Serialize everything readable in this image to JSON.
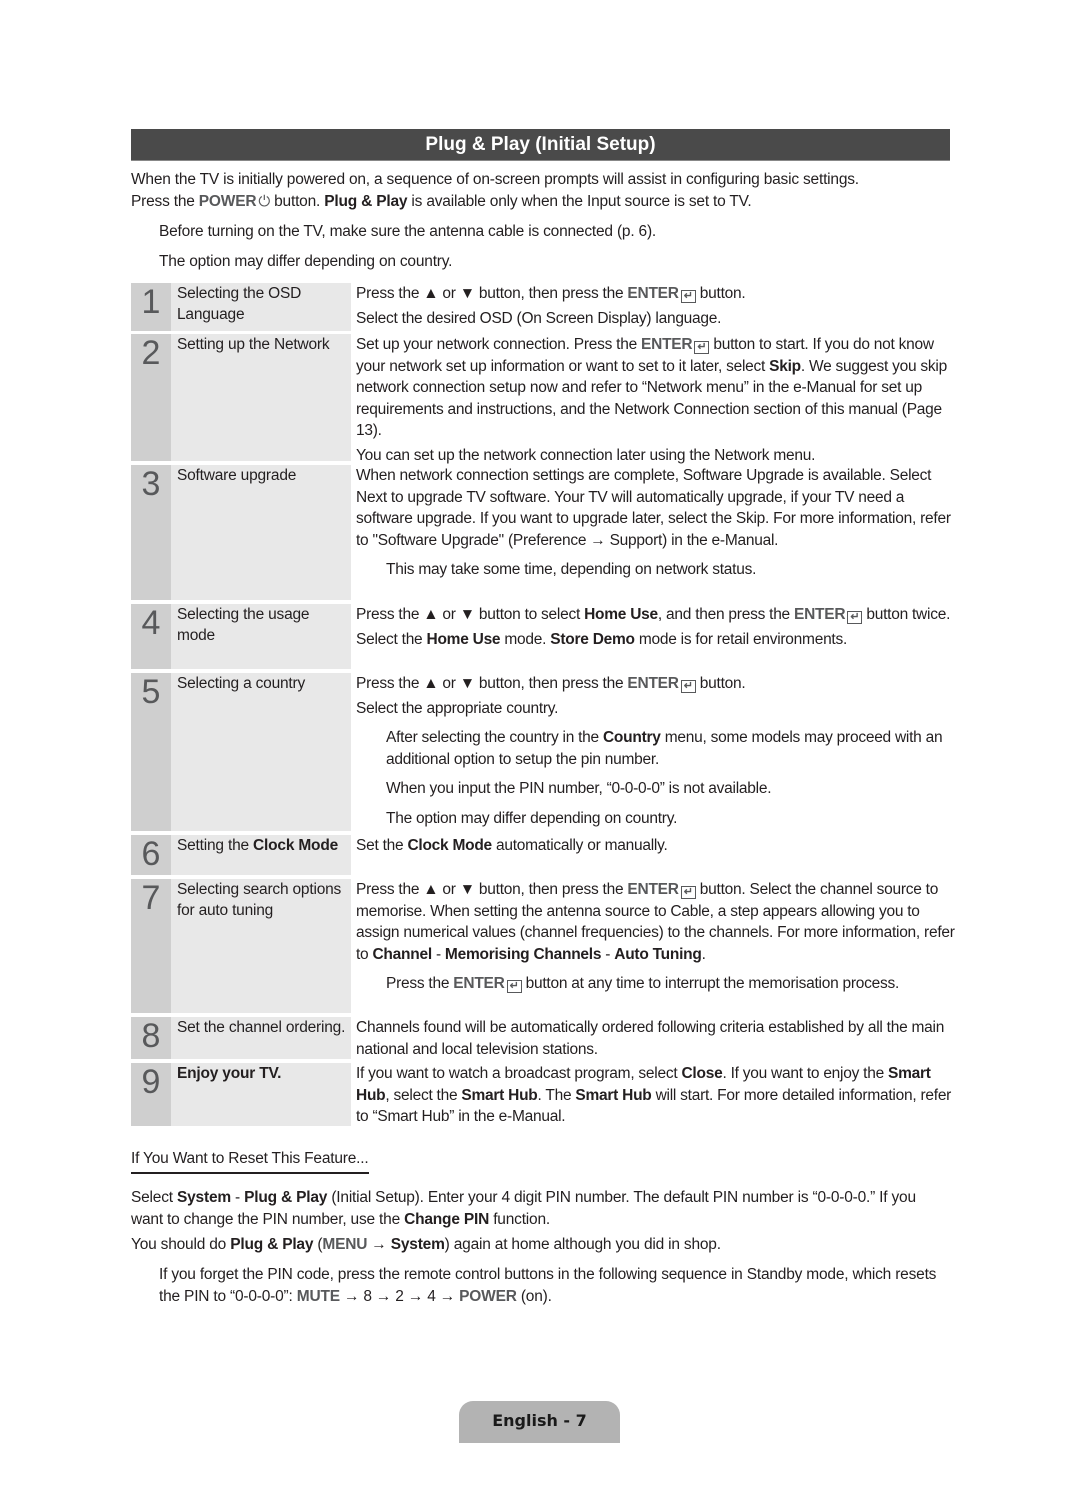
{
  "title": "Plug & Play (Initial Setup)",
  "intro": {
    "line1": "When the TV is initially powered on, a sequence of on-screen prompts will assist in configuring basic settings.",
    "line2_a": "Press the ",
    "power_label": "POWER",
    "power_icon": "power-icon",
    "line2_b": " button. ",
    "plug_play": "Plug & Play",
    "line2_c": " is available only when the Input source is set to TV."
  },
  "notes": [
    "Before turning on the TV, make sure the antenna cable is connected (p. 6).",
    "The option may differ depending on country."
  ],
  "enter_label": "ENTER",
  "enter_icon": "enter-icon",
  "steps": [
    {
      "number": "1",
      "label": "Selecting the OSD Language",
      "lines": [
        {
          "a": "Press the ▲ or ▼ button, then press the ",
          "b": " button."
        },
        "Select the desired OSD (On Screen Display) language."
      ]
    },
    {
      "number": "2",
      "label": "Setting up the Network",
      "lines": [
        {
          "a": "Set up your network connection. Press the ",
          "b": " button to start. If you do not know your network set up information or want to set to it later, select ",
          "bold": "Skip",
          "c": ". We suggest you skip network connection setup now and refer to “Network menu” in the e-Manual for set up requirements and instructions, and the Network Connection section of this manual (Page 13)."
        },
        "You can set up the network connection later using the Network menu."
      ]
    },
    {
      "number": "3",
      "label": "Software upgrade",
      "lines": [
        "When network connection settings are complete, Software Upgrade is available. Select Next to upgrade TV software. Your TV will automatically upgrade, if your TV need a software upgrade. If you want to upgrade later, select the Skip. For more information, refer to \"Software Upgrade\" (Preference → Support) in the e-Manual."
      ],
      "notes": [
        "This may take some time, depending on network status."
      ]
    },
    {
      "number": "4",
      "label": "Selecting the usage mode",
      "lines": [
        {
          "a": "Press the ▲ or ▼ button to select ",
          "bold": "Home Use",
          "b": ", and then press the ",
          "c": " button twice."
        },
        {
          "a": "Select the ",
          "bold1": "Home Use",
          "b": " mode. ",
          "bold2": "Store Demo",
          "c": " mode is for retail environments."
        }
      ]
    },
    {
      "number": "5",
      "label": "Selecting a country",
      "lines": [
        {
          "a": "Press the ▲ or ▼ button, then press the ",
          "b": " button."
        },
        "Select the appropriate country."
      ],
      "notes": [
        {
          "a": "After selecting the country in the ",
          "bold": "Country",
          "b": " menu, some models may proceed with an additional option to setup the pin number."
        },
        "When you input the PIN number, “0-0-0-0” is not available.",
        "The option may differ depending on country."
      ]
    },
    {
      "number": "6",
      "label_a": "Setting the ",
      "label_bold": "Clock Mode",
      "lines": [
        {
          "a": "Set the ",
          "bold": "Clock Mode",
          "b": " automatically or manually."
        }
      ]
    },
    {
      "number": "7",
      "label": "Selecting search options for auto tuning",
      "lines": [
        {
          "a": "Press the ▲ or ▼ button, then press the ",
          "b": " button. Select the channel source to memorise. When setting the antenna source to Cable, a step appears allowing you to assign numerical values (channel frequencies) to the channels. For more information, refer to ",
          "bold1": "Channel",
          "sep1": " - ",
          "bold2": "Memorising Channels",
          "sep2": " - ",
          "bold3": "Auto Tuning",
          "c": "."
        }
      ],
      "notes": [
        {
          "a": "Press the ",
          "b": " button at any time to interrupt the memorisation process."
        }
      ]
    },
    {
      "number": "8",
      "label": "Set the channel ordering.",
      "lines": [
        "Channels found will be automatically ordered following criteria established by all the main national and local television stations."
      ]
    },
    {
      "number": "9",
      "label": "Enjoy your TV.",
      "lines": [
        {
          "a": "If you want to watch a broadcast program, select ",
          "bold1": "Close",
          "b": ". If you want to enjoy the ",
          "bold2": "Smart Hub",
          "c": ", select the ",
          "bold3": "Smart Hub",
          "d": ". The ",
          "bold4": "Smart Hub",
          "e": " will start. For more detailed information, refer to “Smart Hub” in the e-Manual."
        }
      ]
    }
  ],
  "reset": {
    "heading": "If You Want to Reset This Feature...",
    "p1": {
      "a": "Select ",
      "bold1": "System",
      "sep": " - ",
      "bold2": "Plug & Play",
      "b": " (Initial Setup). Enter your 4 digit PIN number. The default PIN number is “0-0-0-0.” If you want to change the PIN number, use the ",
      "bold3": "Change PIN",
      "c": " function."
    },
    "p2": {
      "a": "You should do ",
      "bold1": "Plug & Play",
      "b": " (",
      "menu": "MENU",
      "arrow": " → ",
      "bold2": "System",
      "c": ") again at home although you did in shop."
    },
    "p3": {
      "a": "If you forget the PIN code, press the remote control buttons in the following sequence in Standby mode, which resets the PIN to “0-0-0-0”: ",
      "mute": "MUTE",
      "seq": " → 8 → 2 → 4 → ",
      "power": "POWER",
      "c": " (on)."
    }
  },
  "footer": {
    "page_label": "English - 7"
  }
}
